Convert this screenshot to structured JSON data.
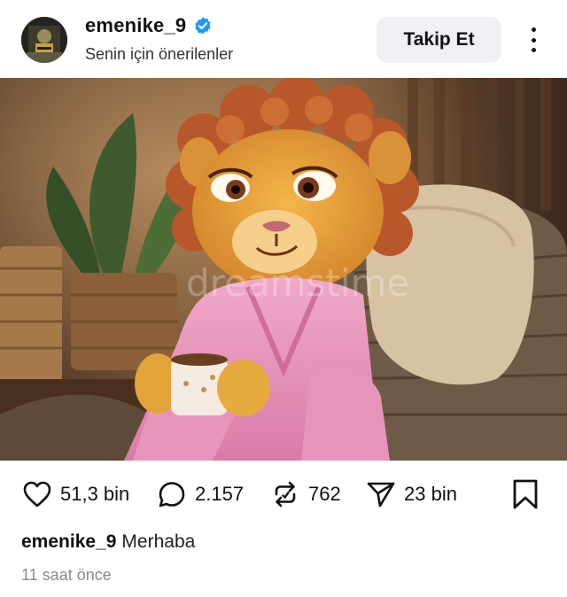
{
  "post": {
    "username": "emenike_9",
    "subtitle": "Senin için önerilenler",
    "follow_label": "Takip Et",
    "verified_color": "#1d9bf0",
    "image_watermark": "dreamstime",
    "image_icons": [
      "avatar",
      "verified-badge-icon"
    ],
    "stats": {
      "likes": "51,3 bin",
      "comments": "2.157",
      "reposts": "762",
      "shares": "23 bin"
    },
    "caption_user": "emenike_9",
    "caption_text": "Merhaba",
    "timestamp": "11 saat önce"
  }
}
